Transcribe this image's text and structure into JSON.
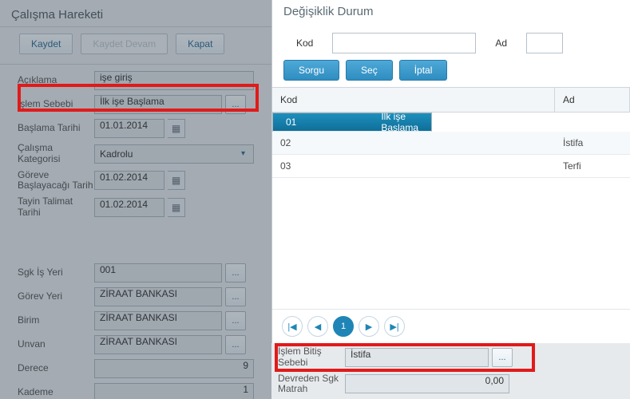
{
  "left": {
    "title": "Çalışma Hareketi",
    "actions": {
      "save": "Kaydet",
      "saveCont": "Kaydet Devam",
      "close": "Kapat"
    },
    "labels": {
      "aciklama": "Açıklama",
      "islemSebebi": "İşlem Sebebi",
      "baslamaTarihi": "Başlama Tarihi",
      "calismaKategorisi": "Çalışma Kategorisi",
      "goreveBaslayacagiTarih": "Göreve Başlayacağı Tarih",
      "tayinTalimatTarihi": "Tayin Talimat Tarihi",
      "sgkIsYeri": "Sgk İş Yeri",
      "gorevYeri": "Görev Yeri",
      "birim": "Birim",
      "unvan": "Unvan",
      "derece": "Derece",
      "kademe": "Kademe"
    },
    "values": {
      "aciklama": "işe giriş",
      "islemSebebi": "İlk işe Başlama",
      "baslamaTarihi": "01.01.2014",
      "calismaKategorisi": "Kadrolu",
      "goreveBaslayacagiTarih": "01.02.2014",
      "tayinTalimatTarihi": "01.02.2014",
      "sgkIsYeri": "001",
      "gorevYeri": "ZİRAAT BANKASI",
      "birim": "ZİRAAT BANKASI",
      "unvan": "ZİRAAT BANKASI",
      "derece": "9",
      "kademe": "1"
    }
  },
  "modal": {
    "title": "Değişiklik Durum",
    "searchLabels": {
      "kod": "Kod",
      "ad": "Ad"
    },
    "actions": {
      "sorgu": "Sorgu",
      "sec": "Seç",
      "iptal": "İptal"
    },
    "cols": {
      "kod": "Kod",
      "ad": "Ad"
    },
    "rows": [
      {
        "kod": "01",
        "ad": "İlk işe Başlama",
        "selected": true
      },
      {
        "kod": "02",
        "ad": "İstifa"
      },
      {
        "kod": "03",
        "ad": "Terfi"
      }
    ],
    "pager": {
      "page": "1"
    }
  },
  "below": {
    "labels": {
      "islemBitisSebebi": "İşlem Bitiş Sebebi",
      "devredenSgkMatrah": "Devreden Sgk Matrah"
    },
    "values": {
      "islemBitisSebebi": "İstifa",
      "devredenSgkMatrah": "0,00"
    }
  },
  "glyphs": {
    "dots": "...",
    "cal": "▦",
    "caret": "▾",
    "first": "|◀",
    "prev": "◀",
    "next": "▶",
    "last": "▶|"
  }
}
